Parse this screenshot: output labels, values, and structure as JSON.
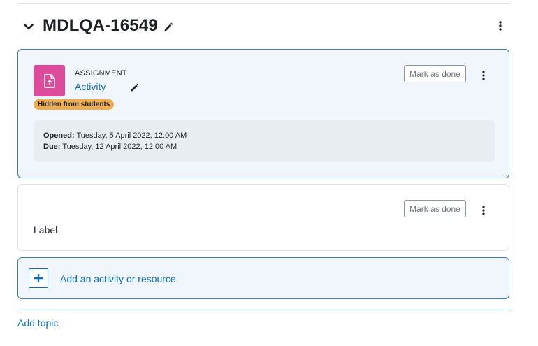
{
  "section": {
    "title": "MDLQA-16549",
    "collapse_icon": "chevron-down-icon",
    "edit_icon": "pencil-icon",
    "menu_icon": "kebab-icon"
  },
  "assignment": {
    "type_label": "ASSIGNMENT",
    "name": "Activity",
    "icon": "assignment-upload-icon",
    "badge": "Hidden from students",
    "mark_done_label": "Mark as done",
    "dates": {
      "opened_label": "Opened:",
      "opened_value": "Tuesday, 5 April 2022, 12:00 AM",
      "due_label": "Due:",
      "due_value": "Tuesday, 12 April 2022, 12:00 AM"
    }
  },
  "label_item": {
    "text": "Label",
    "mark_done_label": "Mark as done"
  },
  "add_activity": {
    "label": "Add an activity or resource",
    "icon": "plus-icon"
  },
  "add_topic": "Add topic",
  "colors": {
    "accent": "#0f6cbf",
    "assignment_icon_bg": "#dc4c9a",
    "badge_bg": "#f0ad4e",
    "highlight_border": "#3d7ab7"
  }
}
